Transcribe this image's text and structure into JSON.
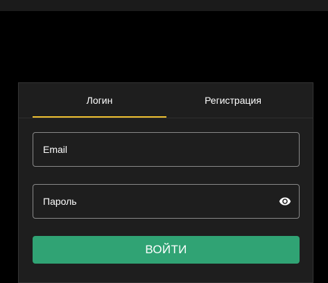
{
  "tabs": {
    "login": "Логин",
    "register": "Регистрация",
    "active": "login",
    "active_color": "#f0c232"
  },
  "form": {
    "email_placeholder": "Email",
    "password_placeholder": "Пароль",
    "password_toggle_icon": "eye-icon",
    "submit_label": "ВОЙТИ",
    "submit_color": "#30a374"
  }
}
